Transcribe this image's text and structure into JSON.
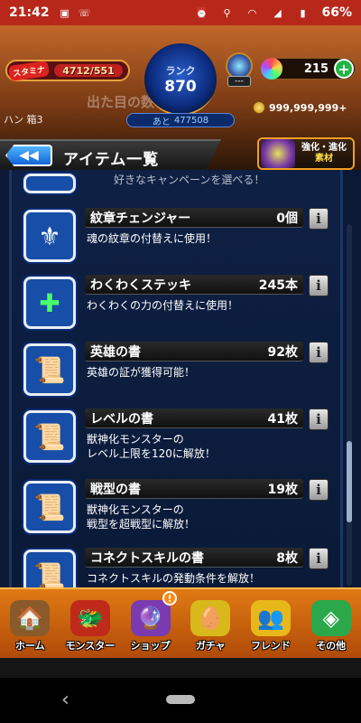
{
  "status_bar": {
    "time": "21:42",
    "battery": "66%",
    "icons": [
      "image-icon",
      "phone-wifi-icon",
      "alarm-icon",
      "location-icon",
      "wifi-icon",
      "signal-icon",
      "battery-icon"
    ]
  },
  "header": {
    "stamina_label": "スタミナ",
    "stamina_value": "4712/551",
    "rank_label": "ランク",
    "rank_value": "870",
    "exp_prefix": "あと",
    "exp_value": "477508",
    "gem_sub": "---",
    "orb_count": "215",
    "orb_add": "+",
    "coins": "999,999,999+",
    "deck_label": "ハン 箱3",
    "background_text": "出た目の数"
  },
  "title_bar": {
    "back_symbol": "◀◀",
    "title": "アイテム一覧",
    "evo_badge_line1": "強化・進化",
    "evo_badge_line2": "素材"
  },
  "list": {
    "peek_text": "好きなキャンペーンを選べる！",
    "items": [
      {
        "name": "紋章チェンジャー",
        "count": "0個",
        "desc": "魂の紋章の付替えに使用！",
        "icon": "emblem-changer-icon",
        "glyph": "⚜"
      },
      {
        "name": "わくわくステッキ",
        "count": "245本",
        "desc": "わくわくの力の付替えに使用！",
        "icon": "wakuwaku-stick-icon",
        "glyph": "✚"
      },
      {
        "name": "英雄の書",
        "count": "92枚",
        "desc": "英雄の証が獲得可能！",
        "icon": "hero-book-icon",
        "glyph": "📜"
      },
      {
        "name": "レベルの書",
        "count": "41枚",
        "desc": "獣神化モンスターの\nレベル上限を120に解放！",
        "icon": "level-book-icon",
        "glyph": "📜"
      },
      {
        "name": "戦型の書",
        "count": "19枚",
        "desc": "獣神化モンスターの\n戦型を超戦型に解放！",
        "icon": "battle-type-book-icon",
        "glyph": "📜"
      },
      {
        "name": "コネクトスキルの書",
        "count": "8枚",
        "desc": "コネクトスキルの発動条件を解放！",
        "icon": "connect-skill-book-icon",
        "glyph": "📜"
      }
    ],
    "info_symbol": "i"
  },
  "bottom_nav": {
    "items": [
      {
        "label": "ホーム",
        "icon": "home-icon",
        "glyph": "🏠",
        "color": "#8a5a2a"
      },
      {
        "label": "モンスター",
        "icon": "monster-icon",
        "glyph": "🐲",
        "color": "#c02a1a"
      },
      {
        "label": "ショップ",
        "icon": "shop-orb-icon",
        "glyph": "🔮",
        "color": "#7a3ab0"
      },
      {
        "label": "ガチャ",
        "icon": "gacha-egg-icon",
        "glyph": "🥚",
        "color": "#d8b81a"
      },
      {
        "label": "フレンド",
        "icon": "friend-icon",
        "glyph": "👥",
        "color": "#e8b81a"
      },
      {
        "label": "その他",
        "icon": "other-menu-icon",
        "glyph": "◈",
        "color": "#2aa84a"
      }
    ],
    "shop_badge": "!"
  },
  "colors": {
    "status_bar": "#b8281a",
    "list_bg": "#0b1836",
    "nav_bg": "#e07a14"
  }
}
